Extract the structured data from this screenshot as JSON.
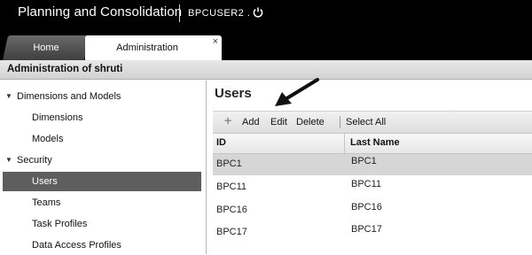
{
  "app": {
    "title": "Planning and Consolidation",
    "user": "BPCUSER2 ."
  },
  "tabs": [
    {
      "label": "Home"
    },
    {
      "label": "Administration",
      "close": "×"
    }
  ],
  "page_header": "Administration of shruti",
  "sidebar": {
    "groups": [
      {
        "label": "Dimensions and Models",
        "items": [
          {
            "label": "Dimensions"
          },
          {
            "label": "Models"
          }
        ]
      },
      {
        "label": "Security",
        "items": [
          {
            "label": "Users",
            "active": true
          },
          {
            "label": "Teams"
          },
          {
            "label": "Task Profiles"
          },
          {
            "label": "Data Access Profiles"
          }
        ]
      }
    ]
  },
  "main": {
    "title": "Users",
    "toolbar": {
      "add": "Add",
      "edit": "Edit",
      "delete": "Delete",
      "select_all": "Select All"
    },
    "table": {
      "columns": [
        "ID",
        "Last Name"
      ],
      "rows": [
        {
          "id": "BPC1",
          "last_name": "BPC1"
        },
        {
          "id": "BPC11",
          "last_name": "BPC11"
        },
        {
          "id": "BPC16",
          "last_name": "BPC16"
        },
        {
          "id": "BPC17",
          "last_name": "BPC17"
        }
      ]
    }
  },
  "icons": {
    "power": "power-icon",
    "add": "plus-icon",
    "expand": "caret-down-icon",
    "annotation": "arrow-icon"
  },
  "colors": {
    "topbar": "#000000",
    "selected_nav": "#5e5e5e",
    "selected_row": "#d6d6d6"
  }
}
